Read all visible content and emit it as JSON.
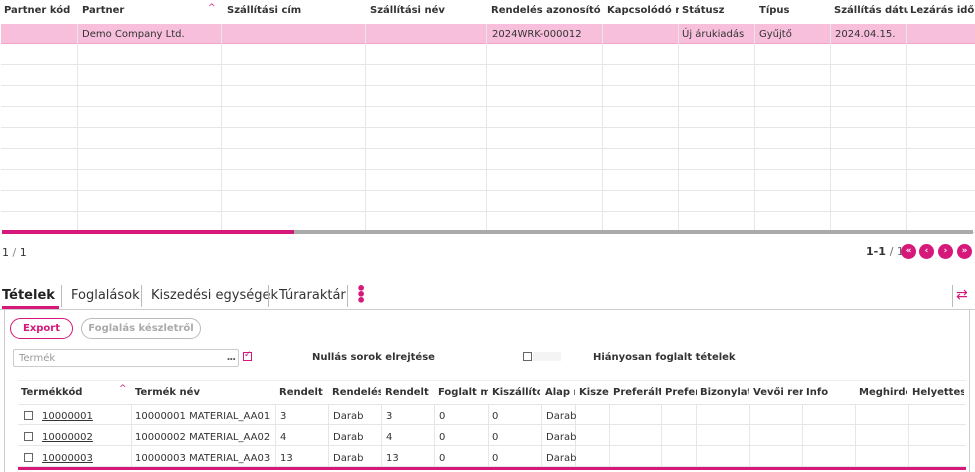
{
  "top_grid": {
    "columns": [
      "Partner kód",
      "Partner",
      "Szállítási cím",
      "Szállítási név",
      "Rendelés azonosító",
      "Kapcsolódó re",
      "Státusz",
      "Típus",
      "Szállítás dátur",
      "Lezárás időp"
    ],
    "rows": [
      {
        "partner_kod": "",
        "partner": "Demo Company Ltd.",
        "szall_cim": "",
        "szall_nev": "",
        "rendeles_az": "2024WRK-000012",
        "kapcsolodo": "",
        "statusz": "Új árukiadás",
        "tipus": "Gyűjtő",
        "szall_datum": "2024.04.15.",
        "lezaras": ""
      }
    ]
  },
  "pager": {
    "page_current": "1",
    "page_sep": "/",
    "page_total": "1",
    "range": "1-1",
    "range_total": "/ 1",
    "first": "«",
    "prev": "‹",
    "next": "›",
    "last": "»"
  },
  "tabs": [
    {
      "label": "Tételek",
      "active": true
    },
    {
      "label": "Foglalások",
      "active": false
    },
    {
      "label": "Kiszedési egységek",
      "active": false
    },
    {
      "label": "Túraraktár",
      "active": false
    }
  ],
  "toolbar": {
    "export_label": "Export",
    "foglalas_label": "Foglalás készletről"
  },
  "filters": {
    "search_placeholder": "Termék",
    "search_dots": "...",
    "nullas_label": "Nullás sorok elrejtése",
    "nullas_checked": true,
    "hianyosan_label": "Hiányosan foglalt tételek",
    "hianyosan_checked": false
  },
  "bottom_grid": {
    "columns": [
      "Termékkód",
      "Termék név",
      "Rendelt m",
      "Rendelési",
      "Rendelt m",
      "Foglalt m.",
      "Kiszállíto",
      "Alap m",
      "Kiszec",
      "Preferált",
      "Prefer",
      "Bizonylat",
      "Vevői ren",
      "Info",
      "Meghirde",
      "Helyettes"
    ],
    "rows": [
      {
        "kod": "10000001",
        "nev": "10000001 MATERIAL_AA01",
        "rendelt_m": "3",
        "rendelesi": "Darab",
        "rendelt_m2": "3",
        "foglalt": "0",
        "kiszallit": "0",
        "alap": "Darab"
      },
      {
        "kod": "10000002",
        "nev": "10000002 MATERIAL_AA02",
        "rendelt_m": "4",
        "rendelesi": "Darab",
        "rendelt_m2": "4",
        "foglalt": "0",
        "kiszallit": "0",
        "alap": "Darab"
      },
      {
        "kod": "10000003",
        "nev": "10000003 MATERIAL_AA03",
        "rendelt_m": "13",
        "rendelesi": "Darab",
        "rendelt_m2": "13",
        "foglalt": "0",
        "kiszallit": "0",
        "alap": "Darab"
      }
    ]
  },
  "icons": {
    "sort": "^",
    "swap": "⇄",
    "kebab": "⋮"
  },
  "colors": {
    "accent": "#d6187a",
    "selected_row": "#f7bfdc"
  }
}
